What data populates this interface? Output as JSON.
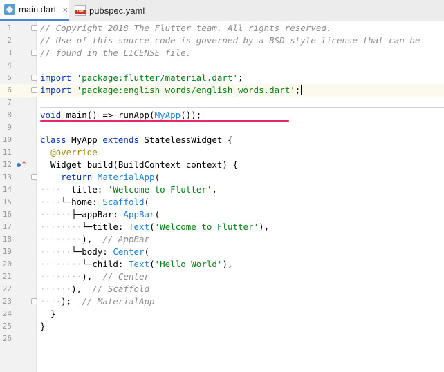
{
  "tabs": [
    {
      "label": "main.dart",
      "icon": "dart-file-icon",
      "active": true,
      "close": "×"
    },
    {
      "label": "pubspec.yaml",
      "icon": "yaml-file-icon",
      "active": false,
      "close": "",
      "icon_text": "YML"
    }
  ],
  "lines": [
    {
      "n": "1",
      "parts": [
        {
          "t": "// Copyright 2018 The Flutter team. All rights reserved.",
          "c": "cmt"
        }
      ]
    },
    {
      "n": "2",
      "parts": [
        {
          "t": "// Use of this source code is governed by a BSD-style license that can be",
          "c": "cmt"
        }
      ]
    },
    {
      "n": "3",
      "parts": [
        {
          "t": "// found in the LICENSE file.",
          "c": "cmt"
        }
      ]
    },
    {
      "n": "4",
      "parts": []
    },
    {
      "n": "5",
      "parts": [
        {
          "t": "import ",
          "c": "kw"
        },
        {
          "t": "'package:flutter/material.dart'",
          "c": "str"
        },
        {
          "t": ";",
          "c": ""
        }
      ]
    },
    {
      "n": "6",
      "parts": [
        {
          "t": "import ",
          "c": "kw"
        },
        {
          "t": "'package:english_words/english_words.dart'",
          "c": "str"
        },
        {
          "t": ";",
          "c": ""
        }
      ]
    },
    {
      "n": "7",
      "parts": []
    },
    {
      "n": "8",
      "parts": [
        {
          "t": "void ",
          "c": "kw"
        },
        {
          "t": "main() => runApp(",
          "c": ""
        },
        {
          "t": "MyApp",
          "c": "cls"
        },
        {
          "t": "());",
          "c": ""
        }
      ]
    },
    {
      "n": "9",
      "parts": []
    },
    {
      "n": "10",
      "parts": [
        {
          "t": "class ",
          "c": "kw"
        },
        {
          "t": "MyApp ",
          "c": ""
        },
        {
          "t": "extends ",
          "c": "kw"
        },
        {
          "t": "StatelessWidget {",
          "c": ""
        }
      ]
    },
    {
      "n": "11",
      "parts": [
        {
          "t": "  ",
          "c": ""
        },
        {
          "t": "@override",
          "c": "ann"
        }
      ]
    },
    {
      "n": "12",
      "parts": [
        {
          "t": "  Widget build(BuildContext context) {",
          "c": ""
        }
      ]
    },
    {
      "n": "13",
      "parts": [
        {
          "t": "    ",
          "c": ""
        },
        {
          "t": "return ",
          "c": "kw"
        },
        {
          "t": "MaterialApp",
          "c": "cls"
        },
        {
          "t": "(",
          "c": ""
        }
      ]
    },
    {
      "n": "14",
      "parts": [
        {
          "t": "····",
          "c": "guide"
        },
        {
          "t": "  title: ",
          "c": ""
        },
        {
          "t": "'Welcome to Flutter'",
          "c": "str"
        },
        {
          "t": ",",
          "c": ""
        }
      ]
    },
    {
      "n": "15",
      "parts": [
        {
          "t": "····",
          "c": "guide"
        },
        {
          "t": "└─home: ",
          "c": ""
        },
        {
          "t": "Scaffold",
          "c": "cls"
        },
        {
          "t": "(",
          "c": ""
        }
      ]
    },
    {
      "n": "16",
      "parts": [
        {
          "t": "······",
          "c": "guide"
        },
        {
          "t": "├─appBar: ",
          "c": ""
        },
        {
          "t": "AppBar",
          "c": "cls"
        },
        {
          "t": "(",
          "c": ""
        }
      ]
    },
    {
      "n": "17",
      "parts": [
        {
          "t": "········",
          "c": "guide"
        },
        {
          "t": "└─title: ",
          "c": ""
        },
        {
          "t": "Text",
          "c": "cls"
        },
        {
          "t": "(",
          "c": ""
        },
        {
          "t": "'Welcome to Flutter'",
          "c": "str"
        },
        {
          "t": "),",
          "c": ""
        }
      ]
    },
    {
      "n": "18",
      "parts": [
        {
          "t": "········",
          "c": "guide"
        },
        {
          "t": "),  ",
          "c": ""
        },
        {
          "t": "// AppBar",
          "c": "cmt"
        }
      ]
    },
    {
      "n": "19",
      "parts": [
        {
          "t": "······",
          "c": "guide"
        },
        {
          "t": "└─body: ",
          "c": ""
        },
        {
          "t": "Center",
          "c": "cls"
        },
        {
          "t": "(",
          "c": ""
        }
      ]
    },
    {
      "n": "20",
      "parts": [
        {
          "t": "········",
          "c": "guide"
        },
        {
          "t": "└─child: ",
          "c": ""
        },
        {
          "t": "Text",
          "c": "cls"
        },
        {
          "t": "(",
          "c": ""
        },
        {
          "t": "'Hello World'",
          "c": "str"
        },
        {
          "t": "),",
          "c": ""
        }
      ]
    },
    {
      "n": "21",
      "parts": [
        {
          "t": "········",
          "c": "guide"
        },
        {
          "t": "),  ",
          "c": ""
        },
        {
          "t": "// Center",
          "c": "cmt"
        }
      ]
    },
    {
      "n": "22",
      "parts": [
        {
          "t": "······",
          "c": "guide"
        },
        {
          "t": "),  ",
          "c": ""
        },
        {
          "t": "// Scaffold",
          "c": "cmt"
        }
      ]
    },
    {
      "n": "23",
      "parts": [
        {
          "t": "····",
          "c": "guide"
        },
        {
          "t": ");  ",
          "c": ""
        },
        {
          "t": "// MaterialApp",
          "c": "cmt"
        }
      ]
    },
    {
      "n": "24",
      "parts": [
        {
          "t": "  }",
          "c": ""
        }
      ]
    },
    {
      "n": "25",
      "parts": [
        {
          "t": "}",
          "c": ""
        }
      ]
    },
    {
      "n": "26",
      "parts": []
    }
  ],
  "cursor_line": "6",
  "colors": {
    "keyword": "#0033b3",
    "string": "#067d17",
    "comment": "#8c8c8c",
    "class": "#1a7fd4",
    "annotation": "#9e880d",
    "highlight_underline": "#e8276b",
    "active_tab": "#4b84d6"
  }
}
